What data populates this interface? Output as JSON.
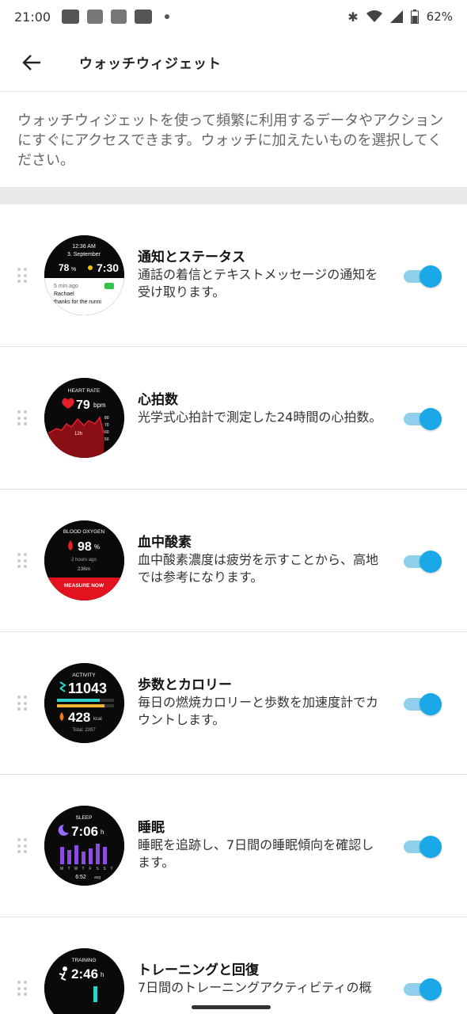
{
  "status_bar": {
    "time": "21:00",
    "battery": "62%",
    "icons": [
      "bluetooth-icon",
      "wifi-icon",
      "signal-icon",
      "battery-icon"
    ]
  },
  "app_bar": {
    "title": "ウォッチウィジェット",
    "back_icon": "arrow-left-icon"
  },
  "intro": "ウォッチウィジェットを使って頻繁に利用するデータやアクションにすぐにアクセスできます。ウォッチに加えたいものを選択してください。",
  "accent_color": "#1aa8e8",
  "widgets": [
    {
      "title": "通知とステータス",
      "description": "通話の着信とテキストメッセージの通知を受け取ります。",
      "enabled": true,
      "preview": {
        "time": "12:36 AM",
        "date": "3. September",
        "battery": "78",
        "unit": "%",
        "clock": "7:30",
        "ago": "5 min ago",
        "sender": "Rachael",
        "message": "thanks for the runni"
      }
    },
    {
      "title": "心拍数",
      "description": "光学式心拍計で測定した24時間の心拍数。",
      "enabled": true,
      "preview": {
        "label": "HEART RATE",
        "value": "79",
        "unit": "bpm",
        "range": "12h",
        "scale": [
          "80",
          "70",
          "60",
          "50"
        ]
      }
    },
    {
      "title": "血中酸素",
      "description": "血中酸素濃度は疲労を示すことから、高地では参考になります。",
      "enabled": true,
      "preview": {
        "label": "BLOOD OXYGEN",
        "value": "98",
        "unit": "%",
        "ago": "2 hours ago",
        "altitude": "236m",
        "action": "MEASURE NOW"
      }
    },
    {
      "title": "歩数とカロリー",
      "description": "毎日の燃焼カロリーと歩数を加速度計でカウントします。",
      "enabled": true,
      "preview": {
        "label": "ACTIVITY",
        "steps": "11043",
        "kcal": "428",
        "kcal_unit": "kcal",
        "total": "Total: 2397"
      }
    },
    {
      "title": "睡眠",
      "description": "睡眠を追跡し、7日間の睡眠傾向を確認します。",
      "enabled": true,
      "preview": {
        "label": "SLEEP",
        "value": "7:06",
        "unit": "h",
        "days": [
          "M",
          "T",
          "W",
          "T",
          "F",
          "S",
          "S",
          "T"
        ],
        "avg": "6:52",
        "avg_unit": "avg"
      }
    },
    {
      "title": "トレーニングと回復",
      "description": "7日間のトレーニングアクティビティの概",
      "enabled": true,
      "preview": {
        "label": "TRAINING",
        "value": "2:46",
        "unit": "h"
      }
    }
  ]
}
